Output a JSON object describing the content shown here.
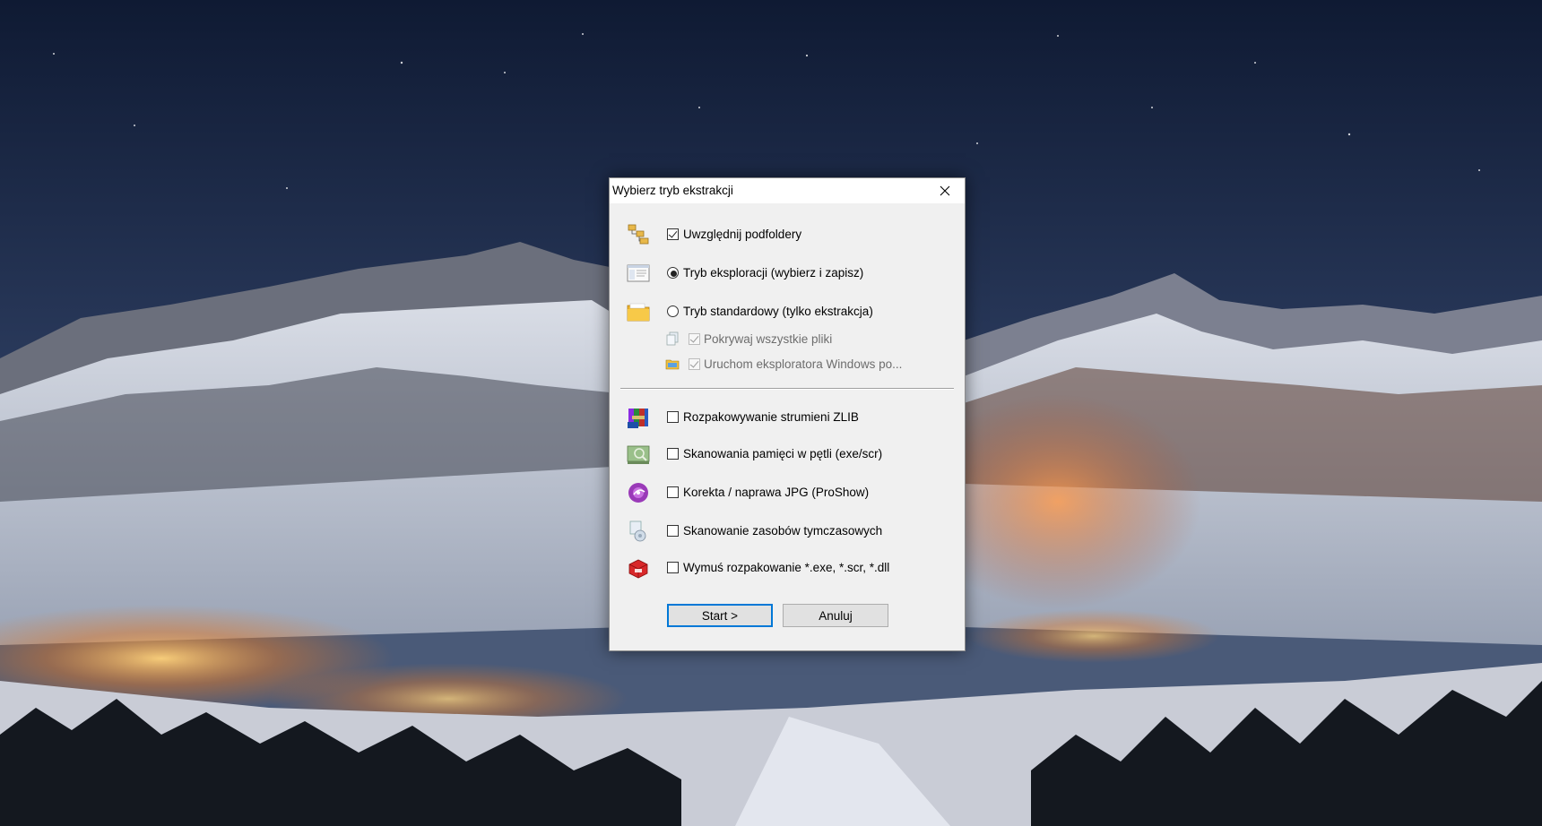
{
  "dialog": {
    "title": "Wybierz tryb ekstrakcji",
    "options": [
      {
        "label": "Uwzględnij podfoldery",
        "control": "checkbox",
        "checked": true,
        "icon": "folder-tree-icon"
      },
      {
        "label": "Tryb eksploracji (wybierz i zapisz)",
        "control": "radio",
        "checked": true,
        "icon": "explorer-window-icon"
      },
      {
        "label": "Tryb standardowy (tylko ekstrakcja)",
        "control": "radio",
        "checked": false,
        "icon": "yellow-folder-icon"
      },
      {
        "label": "Pokrywaj wszystkie pliki",
        "control": "checkbox",
        "checked": true,
        "disabled": true,
        "icon": "copy-files-icon"
      },
      {
        "label": "Uruchom eksploratora Windows po...",
        "control": "checkbox",
        "checked": true,
        "disabled": true,
        "icon": "windows-explorer-icon"
      },
      {
        "label": "Rozpakowywanie strumieni ZLIB",
        "control": "checkbox",
        "checked": false,
        "icon": "zlib-archive-icon"
      },
      {
        "label": "Skanowania pamięci w pętli (exe/scr)",
        "control": "checkbox",
        "checked": false,
        "icon": "memory-scan-icon"
      },
      {
        "label": "Korekta / naprawa JPG (ProShow)",
        "control": "checkbox",
        "checked": false,
        "icon": "proshow-disc-icon"
      },
      {
        "label": "Skanowanie zasobów tymczasowych",
        "control": "checkbox",
        "checked": false,
        "icon": "temp-resources-icon"
      },
      {
        "label": "Wymuś rozpakowanie *.exe, *.scr, *.dll",
        "control": "checkbox",
        "checked": false,
        "icon": "red-box-icon"
      }
    ],
    "buttons": {
      "start": "Start >",
      "cancel": "Anuluj"
    }
  },
  "colors": {
    "accent": "#0078d7",
    "dialog_bg": "#f0f0f0",
    "titlebar_bg": "#ffffff"
  }
}
